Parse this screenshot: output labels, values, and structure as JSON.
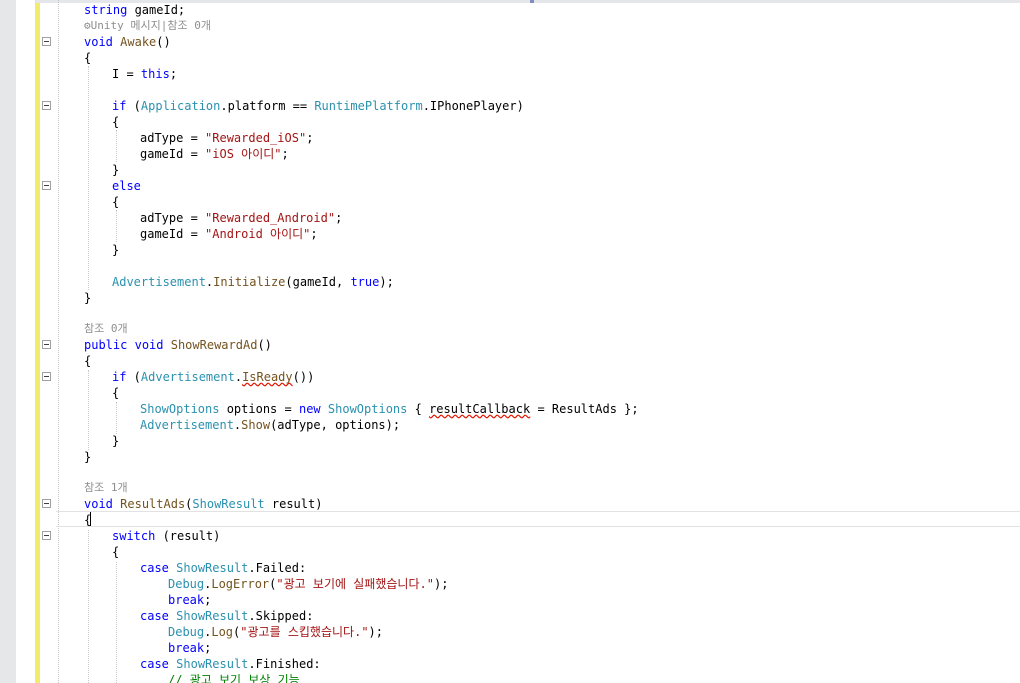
{
  "editor": {
    "lens_unity": "Unity 메시지|참조 0개",
    "lens_refs_0": "참조 0개",
    "lens_refs_1": "참조 1개",
    "kw": {
      "string": "string",
      "void": "void",
      "this": "this",
      "if": "if",
      "else": "else",
      "true": "true",
      "public": "public",
      "new": "new",
      "switch": "switch",
      "case": "case",
      "break": "break"
    },
    "types": {
      "Application": "Application",
      "RuntimePlatform": "RuntimePlatform",
      "Advertisement": "Advertisement",
      "ShowOptions": "ShowOptions",
      "ShowResult": "ShowResult",
      "Debug": "Debug"
    },
    "methods": {
      "Awake": "Awake",
      "Initialize": "Initialize",
      "ShowRewardAd": "ShowRewardAd",
      "IsReady": "IsReady",
      "Show": "Show",
      "ResultAds": "ResultAds",
      "LogError": "LogError",
      "Log": "Log"
    },
    "strings": {
      "rewarded_ios": "\"Rewarded_iOS\"",
      "ios_id": "\"iOS 아이디\"",
      "rewarded_android": "\"Rewarded_Android\"",
      "android_id": "\"Android 아이디\"",
      "ad_failed": "\"광고 보기에 실패했습니다.\"",
      "ad_skipped": "\"광고를 스킵했습니다.\""
    },
    "comment_reward": "// 광고 보기 보상 기능",
    "code": {
      "gameid_field": " gameId;",
      "paren_pair": "()",
      "open_brace": "{",
      "close_brace": "}",
      "i_assign": "I = ",
      "semicolon": ";",
      "open_paren": " (",
      "platform_eq": ".platform == ",
      "iphone_player": ".IPhonePlayer)",
      "adtype_assign": "adType = ",
      "gameid_assign": "gameId = ",
      "semicolon_only": ";",
      "dot": ".",
      "init_args_open": "(gameId, ",
      "close_semicolon": ");",
      "space": " ",
      "isready_call": "())",
      "options_assign": " options = ",
      "options_brace": " { ",
      "result_callback": "resultCallback",
      "options_end": " = ResultAds };",
      "show_args": "(adType, options);",
      "result_params": " result)",
      "switch_arg": " (result)",
      "failed_label": ".Failed:",
      "skipped_label": ".Skipped:",
      "finished_label": ".Finished:",
      "open_paren_only": "("
    }
  }
}
